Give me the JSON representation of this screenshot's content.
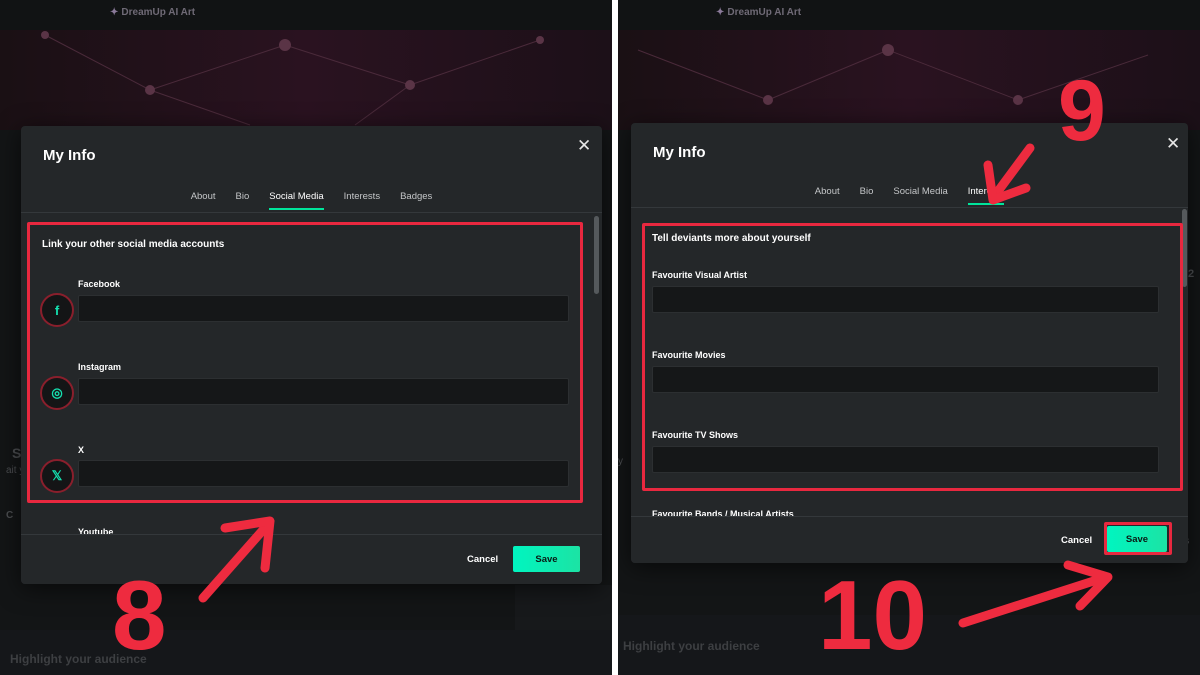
{
  "app": {
    "brand": "DreamUp AI Art"
  },
  "colors": {
    "accent": "#00e59b",
    "annotation": "#ee2b3f",
    "modal_bg": "#242729"
  },
  "icons": {
    "close": "close-icon",
    "facebook": "facebook-icon",
    "instagram": "instagram-icon",
    "x": "x-icon"
  },
  "left": {
    "modal": {
      "title": "My Info",
      "close": "✕",
      "tabs": [
        {
          "label": "About",
          "active": false
        },
        {
          "label": "Bio",
          "active": false
        },
        {
          "label": "Social Media",
          "active": true
        },
        {
          "label": "Interests",
          "active": false
        },
        {
          "label": "Badges",
          "active": false
        }
      ],
      "heading": "Link your other social media accounts",
      "fields": [
        {
          "label": "Facebook",
          "icon_glyph": "f",
          "value": ""
        },
        {
          "label": "Instagram",
          "icon_glyph": "◎",
          "value": ""
        },
        {
          "label": "X",
          "icon_glyph": "𝕏",
          "value": ""
        },
        {
          "label": "Youtube"
        }
      ],
      "cancel": "Cancel",
      "save": "Save"
    },
    "background": {
      "s_glyph": "S",
      "it_glyph": "ait y",
      "c_glyph": "C",
      "bottom_title": "Highlight your audience"
    },
    "step_label": "8"
  },
  "right": {
    "modal": {
      "title": "My Info",
      "close": "✕",
      "tabs": [
        {
          "label": "About",
          "active": false
        },
        {
          "label": "Bio",
          "active": false
        },
        {
          "label": "Social Media",
          "active": false
        },
        {
          "label": "Interests",
          "active": true
        }
      ],
      "heading": "Tell deviants more about yourself",
      "fields": [
        {
          "label": "Favourite Visual Artist",
          "value": ""
        },
        {
          "label": "Favourite Movies",
          "value": ""
        },
        {
          "label": "Favourite TV Shows",
          "value": ""
        },
        {
          "label": "Favourite Bands / Musical Artists"
        }
      ],
      "cancel": "Cancel",
      "save": "Save"
    },
    "background": {
      "bottom_title": "Highlight your audience",
      "nts_glyph": "nts",
      "y_glyph": "y",
      "two_glyph": "2"
    },
    "step_labels": {
      "tabs": "9",
      "save": "10"
    }
  }
}
